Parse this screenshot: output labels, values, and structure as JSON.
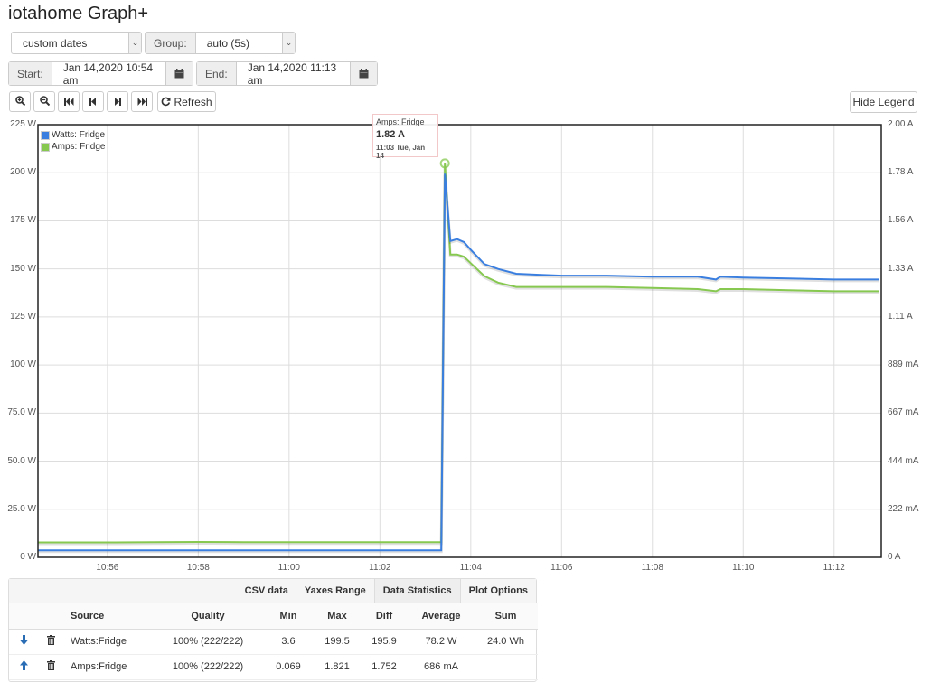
{
  "app_title": "iotahome Graph+",
  "controls": {
    "range_select": "custom dates",
    "group_label": "Group:",
    "group_select": "auto (5s)",
    "start_label": "Start:",
    "start_value": "Jan 14,2020 10:54 am",
    "end_label": "End:",
    "end_value": "Jan 14,2020 11:13 am",
    "refresh_label": "Refresh",
    "hide_legend_label": "Hide Legend"
  },
  "colors": {
    "watts": "#3a7fe0",
    "amps": "#86c850"
  },
  "chart_data": {
    "type": "line",
    "x_range": [
      "10:54.5",
      "11:13"
    ],
    "x_ticks": [
      "10:56",
      "10:58",
      "11:00",
      "11:02",
      "11:04",
      "11:06",
      "11:08",
      "11:10",
      "11:12"
    ],
    "y_left": {
      "range": [
        0,
        225
      ],
      "unit": "W",
      "ticks": [
        "0 W",
        "25.0 W",
        "50.0 W",
        "75.0 W",
        "100 W",
        "125 W",
        "150 W",
        "175 W",
        "200 W",
        "225 W"
      ]
    },
    "y_right": {
      "range": [
        0,
        2.0
      ],
      "unit": "A",
      "ticks": [
        "0 A",
        "222 mA",
        "444 mA",
        "667 mA",
        "889 mA",
        "1.11 A",
        "1.33 A",
        "1.56 A",
        "1.78 A",
        "2.00 A"
      ]
    },
    "grid": true,
    "legend_position": "top-left",
    "series": [
      {
        "name": "Watts: Fridge",
        "axis": "left",
        "x_min": [
          54.47,
          55.0,
          56.0,
          57.0,
          58.0,
          59.0,
          60.0,
          61.0,
          62.0,
          63.0,
          63.35,
          63.43,
          63.55,
          63.7,
          63.85,
          64.0,
          64.3,
          64.6,
          65.0,
          65.5,
          66.0,
          67.0,
          68.0,
          69.0,
          69.4,
          69.5,
          70.0,
          71.0,
          72.0,
          73.0
        ],
        "values": [
          3.6,
          3.6,
          3.6,
          3.6,
          3.6,
          3.6,
          3.6,
          3.6,
          3.6,
          3.6,
          3.6,
          199.5,
          164.5,
          165.5,
          164,
          160,
          152.5,
          150,
          147.5,
          147,
          146.5,
          146.5,
          146,
          146,
          144.5,
          146,
          145.5,
          145,
          144.5,
          144.5
        ]
      },
      {
        "name": "Amps: Fridge",
        "axis": "right",
        "x_min": [
          54.47,
          55.0,
          56.0,
          57.0,
          58.0,
          59.0,
          60.0,
          61.0,
          62.0,
          63.0,
          63.35,
          63.43,
          63.55,
          63.7,
          63.85,
          64.0,
          64.3,
          64.6,
          65.0,
          65.5,
          66.0,
          67.0,
          68.0,
          69.0,
          69.4,
          69.5,
          70.0,
          71.0,
          72.0,
          73.0
        ],
        "values": [
          0.069,
          0.069,
          0.069,
          0.07,
          0.071,
          0.07,
          0.07,
          0.07,
          0.07,
          0.07,
          0.07,
          1.821,
          1.4,
          1.4,
          1.39,
          1.36,
          1.3,
          1.27,
          1.25,
          1.25,
          1.25,
          1.25,
          1.245,
          1.24,
          1.23,
          1.24,
          1.24,
          1.235,
          1.23,
          1.23
        ]
      }
    ],
    "tooltip": {
      "series": "Amps: Fridge",
      "value": "1.82 A",
      "time": "11:03 Tue, Jan 14"
    }
  },
  "panel": {
    "tabs": [
      "CSV data",
      "Yaxes Range",
      "Data Statistics",
      "Plot Options"
    ],
    "active_tab": "Data Statistics",
    "columns": [
      "Source",
      "Quality",
      "Min",
      "Max",
      "Diff",
      "Average",
      "Sum"
    ],
    "rows": [
      {
        "source": "Watts:Fridge",
        "quality": "100% (222/222)",
        "min": "3.6",
        "max": "199.5",
        "diff": "195.9",
        "average": "78.2 W",
        "sum": "24.0 Wh",
        "arrow": "down"
      },
      {
        "source": "Amps:Fridge",
        "quality": "100% (222/222)",
        "min": "0.069",
        "max": "1.821",
        "diff": "1.752",
        "average": "686 mA",
        "sum": "",
        "arrow": "up"
      }
    ]
  }
}
